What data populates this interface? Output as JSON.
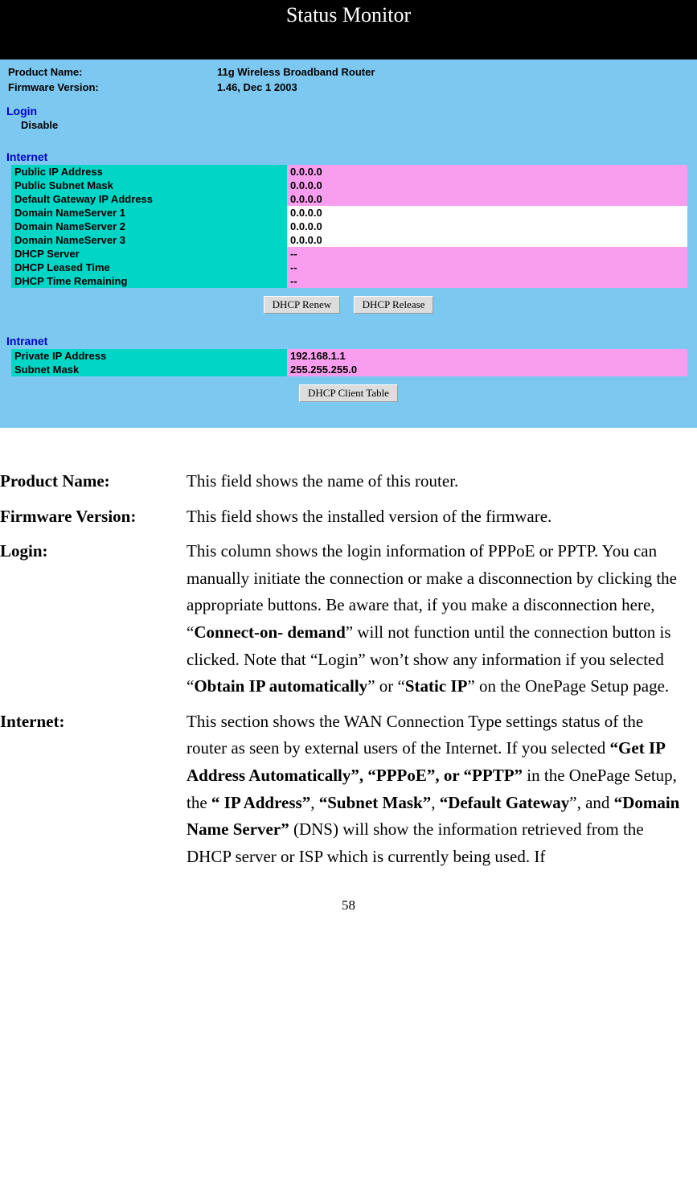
{
  "banner": "Status Monitor",
  "info": {
    "product_name_label": "Product Name:",
    "product_name_value": "11g Wireless Broadband Router",
    "firmware_label": "Firmware Version:",
    "firmware_value": "1.46, Dec 1 2003"
  },
  "login": {
    "header": "Login",
    "value": "Disable"
  },
  "internet": {
    "header": "Internet",
    "rows": [
      {
        "label": "Public IP Address",
        "value": "0.0.0.0",
        "valClass": "cell-value"
      },
      {
        "label": "Public Subnet Mask",
        "value": "0.0.0.0",
        "valClass": "cell-value"
      },
      {
        "label": "Default Gateway IP Address",
        "value": "0.0.0.0",
        "valClass": "cell-value"
      },
      {
        "label": "Domain NameServer 1",
        "value": "0.0.0.0",
        "valClass": "cell-value-white"
      },
      {
        "label": "Domain NameServer 2",
        "value": "0.0.0.0",
        "valClass": "cell-value-white"
      },
      {
        "label": "Domain NameServer 3",
        "value": "0.0.0.0",
        "valClass": "cell-value-white"
      },
      {
        "label": "DHCP Server",
        "value": " --",
        "valClass": "cell-value"
      },
      {
        "label": "DHCP Leased Time",
        "value": " --",
        "valClass": "cell-value"
      },
      {
        "label": "DHCP Time Remaining",
        "value": " --",
        "valClass": "cell-value"
      }
    ],
    "btn_renew": "DHCP Renew",
    "btn_release": "DHCP Release"
  },
  "intranet": {
    "header": "Intranet",
    "rows": [
      {
        "label": "Private IP Address",
        "value": "192.168.1.1"
      },
      {
        "label": "Subnet Mask",
        "value": "255.255.255.0"
      }
    ],
    "btn_client_table": "DHCP Client Table"
  },
  "doc": {
    "product_name": {
      "label": "Product Name:",
      "text": "This field shows the name of this router."
    },
    "firmware": {
      "label": "Firmware Version:",
      "text": "This field shows the installed version of the firmware."
    },
    "login": {
      "label": "Login:",
      "p1": "This column shows the login information of PPPoE or PPTP. You can manually initiate the connection or make a disconnection by clicking the appropriate buttons. Be aware that, if you make a disconnection here, “",
      "b1": "Connect-on- demand",
      "p2": "” will not function until the connection button is clicked. Note that “Login” won’t show any information if you selected “",
      "b2": "Obtain IP automatically",
      "p3": "” or “",
      "b3": "Static IP",
      "p4": "” on the OnePage Setup page."
    },
    "internet": {
      "label": "Internet:",
      "p1": "This section shows the WAN Connection Type settings status of the router as seen by external users of the Internet. If you selected ",
      "b1": "“Get IP Address Automatically”, “PPPoE”, or “PPTP”",
      "p2": " in the OnePage Setup, the ",
      "b2": "“ IP Address”",
      "p3": ", ",
      "b3": "“Subnet Mask”",
      "p4": ", ",
      "b4": "“Default Gateway",
      "p5": "”, and ",
      "b5": "“Domain Name Server”",
      "p6": " (DNS) will show the information retrieved from the DHCP server or ISP which is currently being used. If"
    }
  },
  "page_number": "58"
}
